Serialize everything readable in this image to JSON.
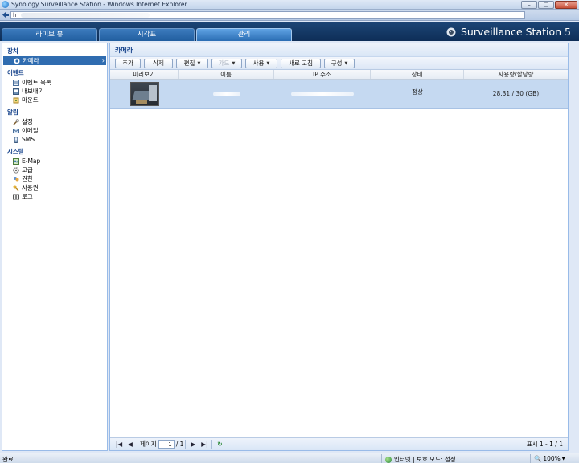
{
  "window": {
    "title": "Synology Surveillance Station - Windows Internet Explorer",
    "minimize": "–",
    "maximize": "□",
    "close": "✕"
  },
  "address": {
    "text": "h"
  },
  "header": {
    "tabs": [
      {
        "label": "라이브 뷰"
      },
      {
        "label": "시각표"
      },
      {
        "label": "관리"
      }
    ],
    "brand": "Surveillance Station 5"
  },
  "sidebar": {
    "sections": [
      {
        "heading": "장치",
        "items": [
          {
            "label": "카메라",
            "selected": true,
            "icon": "camera-icon"
          }
        ]
      },
      {
        "heading": "이벤트",
        "items": [
          {
            "label": "이벤트 목록",
            "icon": "list-icon"
          },
          {
            "label": "내보내기",
            "icon": "export-icon"
          },
          {
            "label": "마운트",
            "icon": "mount-icon"
          }
        ]
      },
      {
        "heading": "알림",
        "items": [
          {
            "label": "설정",
            "icon": "wrench-icon"
          },
          {
            "label": "이메일",
            "icon": "email-icon"
          },
          {
            "label": "SMS",
            "icon": "sms-icon"
          }
        ]
      },
      {
        "heading": "시스템",
        "items": [
          {
            "label": "E-Map",
            "icon": "map-icon"
          },
          {
            "label": "고급",
            "icon": "gear-icon"
          },
          {
            "label": "권한",
            "icon": "shield-icon"
          },
          {
            "label": "사용권",
            "icon": "key-icon"
          },
          {
            "label": "로그",
            "icon": "book-icon"
          }
        ]
      }
    ],
    "selected_arrow": "›"
  },
  "main": {
    "title": "카메라",
    "toolbar": [
      {
        "label": "추가",
        "dropdown": false,
        "disabled": false
      },
      {
        "label": "삭제",
        "dropdown": false,
        "disabled": false
      },
      {
        "label": "편집",
        "dropdown": true,
        "disabled": false
      },
      {
        "label": "가드",
        "dropdown": true,
        "disabled": true
      },
      {
        "label": "사용",
        "dropdown": true,
        "disabled": false
      },
      {
        "label": "새로 고침",
        "dropdown": false,
        "disabled": false
      },
      {
        "label": "구성",
        "dropdown": true,
        "disabled": false
      }
    ],
    "columns": [
      "미리보기",
      "이름",
      "IP 주소",
      "상태",
      "사용량/할당량"
    ],
    "rows": [
      {
        "status": "정상",
        "usage": "28.31 / 30 (GB)"
      }
    ],
    "pager": {
      "page_label": "페이지",
      "page_value": "1",
      "of_total": "/ 1",
      "display": "표시 1 - 1 / 1",
      "first": "|◀",
      "prev": "◀",
      "next": "▶",
      "last": "▶|",
      "refresh": "↻"
    }
  },
  "statusbar": {
    "left": "완료",
    "zone": "인터넷 | 보호 모드: 설정",
    "zoom": "100%"
  },
  "colors": {
    "header_bg": "#0e2e57",
    "tab_active": "#5fa2e3",
    "selected_row": "#c5d9f1",
    "sidebar_selected": "#2f6cb0"
  }
}
